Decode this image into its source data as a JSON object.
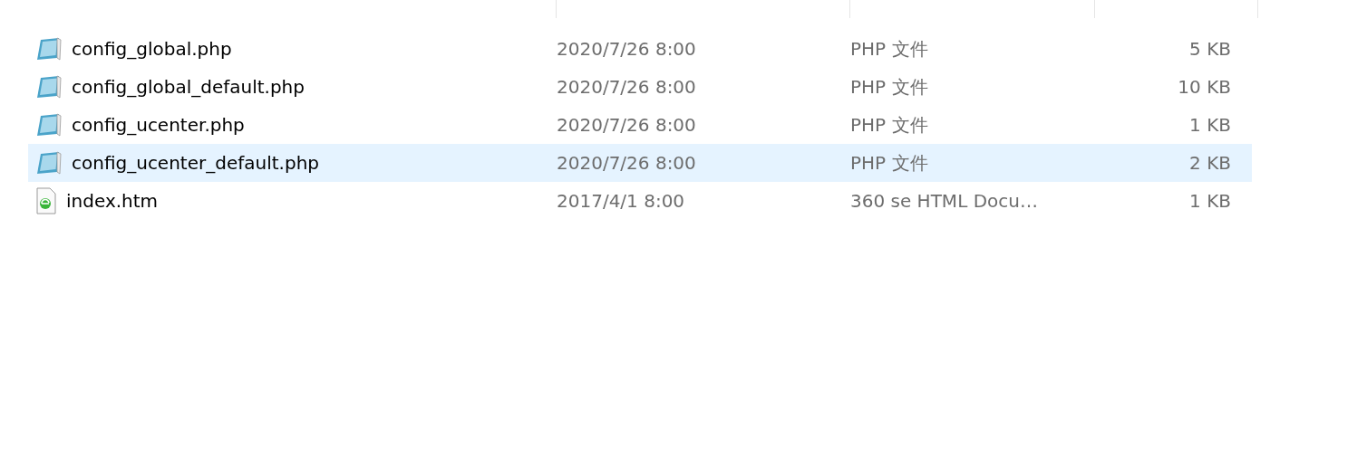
{
  "files": [
    {
      "name": "config_global.php",
      "kind": "php",
      "modified": "2020/7/26 8:00",
      "type": "PHP 文件",
      "size": "5 KB",
      "selected": false
    },
    {
      "name": "config_global_default.php",
      "kind": "php",
      "modified": "2020/7/26 8:00",
      "type": "PHP 文件",
      "size": "10 KB",
      "selected": false
    },
    {
      "name": "config_ucenter.php",
      "kind": "php",
      "modified": "2020/7/26 8:00",
      "type": "PHP 文件",
      "size": "1 KB",
      "selected": false
    },
    {
      "name": "config_ucenter_default.php",
      "kind": "php",
      "modified": "2020/7/26 8:00",
      "type": "PHP 文件",
      "size": "2 KB",
      "selected": true
    },
    {
      "name": "index.htm",
      "kind": "htm",
      "modified": "2017/4/1 8:00",
      "type": "360 se HTML Docu…",
      "size": "1 KB",
      "selected": false
    }
  ]
}
